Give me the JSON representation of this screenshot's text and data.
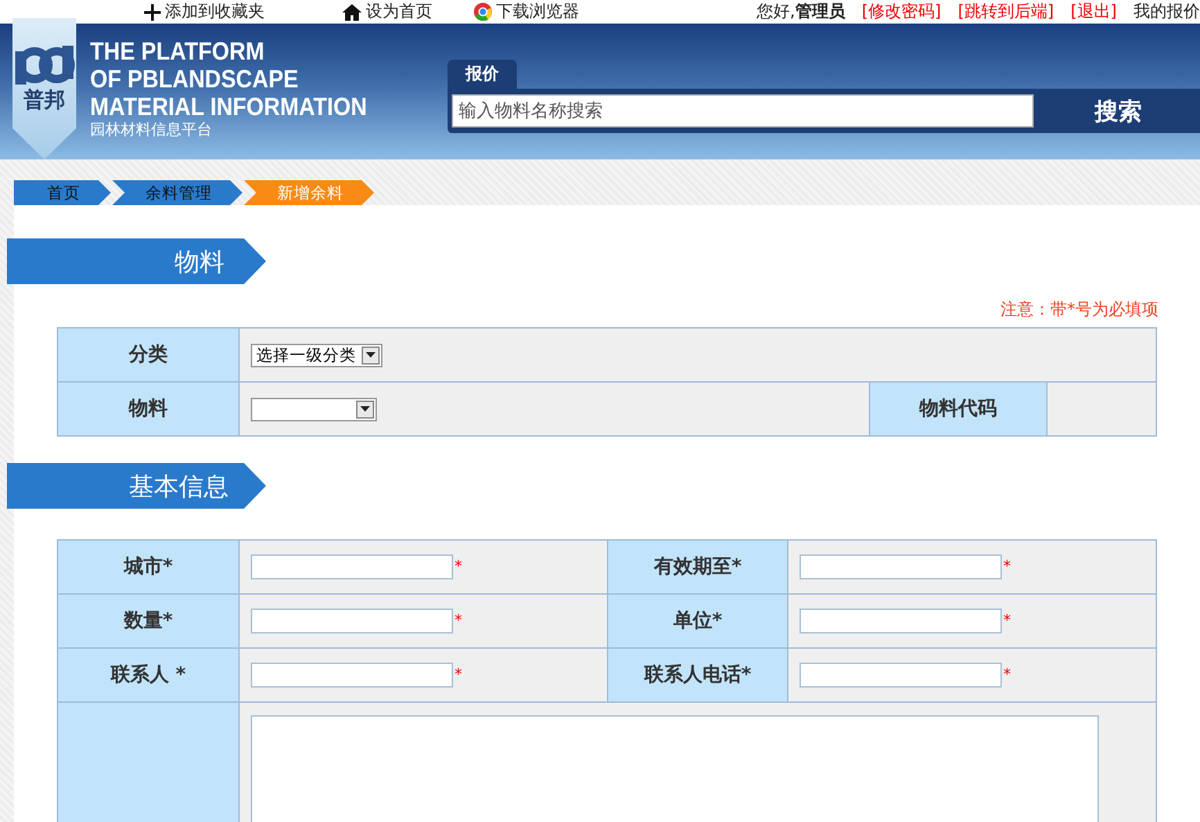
{
  "top_bar": {
    "links": [
      {
        "kind": "plus",
        "label": "添加到收藏夹"
      },
      {
        "kind": "home",
        "label": "设为首页"
      },
      {
        "kind": "browser",
        "label": "下载浏览器"
      }
    ],
    "greeting": "您好,",
    "user": "管理员",
    "account_links": [
      {
        "label": "[修改密码]",
        "kind": "red"
      },
      {
        "label": "[跳转到后端]",
        "kind": "red"
      },
      {
        "label": "[退出]",
        "kind": "red"
      },
      {
        "label": "我的报价",
        "kind": "plain"
      }
    ]
  },
  "header": {
    "logo_text": "普邦",
    "title_lines": [
      "THE PLATFORM",
      "OF PBLANDSCAPE",
      "MATERIAL INFORMATION"
    ],
    "subtitle": "园林材料信息平台",
    "search": {
      "tab": "报价",
      "placeholder": "输入物料名称搜索",
      "button": "搜索"
    }
  },
  "breadcrumb": [
    {
      "label": "首页",
      "selected": false
    },
    {
      "label": "余料管理",
      "selected": false
    },
    {
      "label": "新增余料",
      "selected": true
    }
  ],
  "material_section": {
    "title": "物料",
    "note": "注意：带*号为必填项",
    "category": {
      "label": "分类",
      "value": "选择一级分类"
    },
    "material": {
      "label": "物料"
    },
    "code": {
      "label": "物料代码"
    }
  },
  "basic_section": {
    "title": "基本信息",
    "rows": [
      [
        {
          "label": "城市*",
          "mark": "*"
        },
        {
          "label": "有效期至*",
          "mark": "*"
        }
      ],
      [
        {
          "label": "数量*",
          "mark": "*"
        },
        {
          "label": "单位*",
          "mark": "*"
        }
      ],
      [
        {
          "label": "联系人 *",
          "mark": "*"
        },
        {
          "label": "联系人电话*",
          "mark": "*"
        }
      ]
    ]
  }
}
